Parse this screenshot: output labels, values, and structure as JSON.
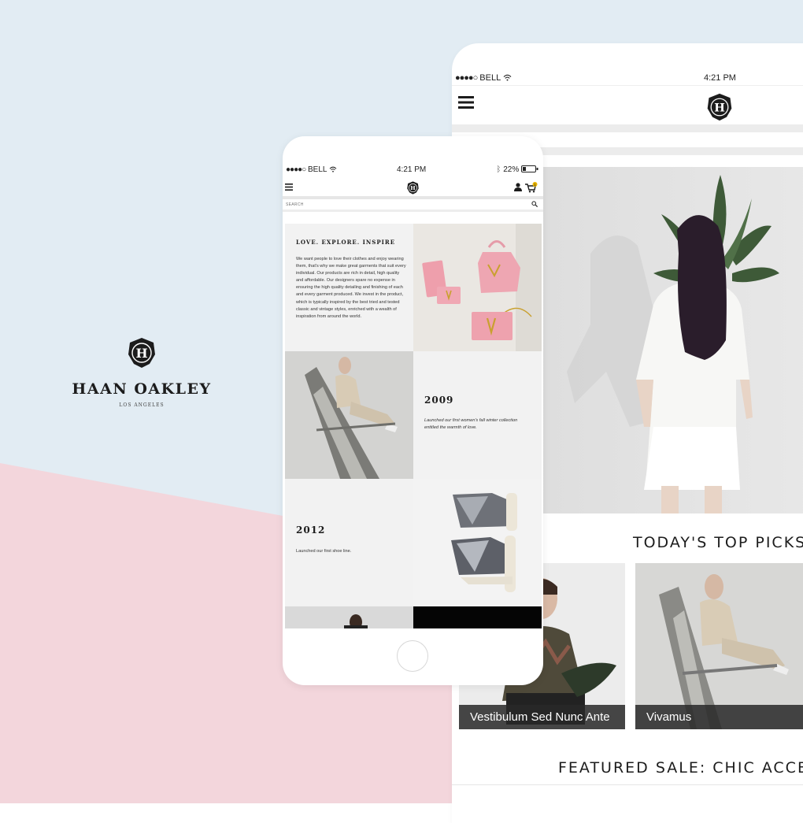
{
  "brand": {
    "name": "HAAN OAKLEY",
    "location": "LOS ANGELES",
    "colors": {
      "bg_blue": "#e2ecf3",
      "bg_pink": "#f3d6dc",
      "ink": "#1c1c1c"
    }
  },
  "back_phone": {
    "status": {
      "carrier": "BELL",
      "time": "4:21 PM"
    },
    "header": {
      "menu_icon": "hamburger-icon",
      "logo_icon": "logo-icon"
    },
    "hero_image": "woman-white-dress-photo",
    "top_picks": {
      "title": "TODAY'S TOP PICKS",
      "cards": [
        {
          "label": "Vestibulum Sed Nunc Ante",
          "image": "man-floral-shirt-photo"
        },
        {
          "label": "Vivamus",
          "image": "woman-in-boat-photo"
        }
      ]
    },
    "featured_title": "FEATURED SALE: CHIC ACCE"
  },
  "front_phone": {
    "status": {
      "carrier": "BELL",
      "time": "4:21 PM",
      "battery": "22%"
    },
    "header": {
      "menu_icon": "hamburger-icon",
      "logo_icon": "logo-icon",
      "user_icon": "user-icon",
      "cart_icon": "cart-icon",
      "cart_count": "1"
    },
    "search": {
      "placeholder": "SEARCH"
    },
    "intro": {
      "title": "LOVE. EXPLORE. INSPIRE",
      "body": "We want people to love their clothes and enjoy wearing them, that's why we make great garments that suit every individual. Our products are rich in detail, high quality and affordable. Our designers spare no expense in ensuring the high quality detailing and finishing of each and every garment produced. We invest in the product, which is typically inspired by the best tried and tested classic and vintage styles, enriched with a wealth of inspiration from around the world."
    },
    "timeline": [
      {
        "year": "2009",
        "description": "Launched our first women's fall winter collection entitled the warmth of love."
      },
      {
        "year": "2012",
        "description": "Launched our first shoe line."
      }
    ]
  }
}
